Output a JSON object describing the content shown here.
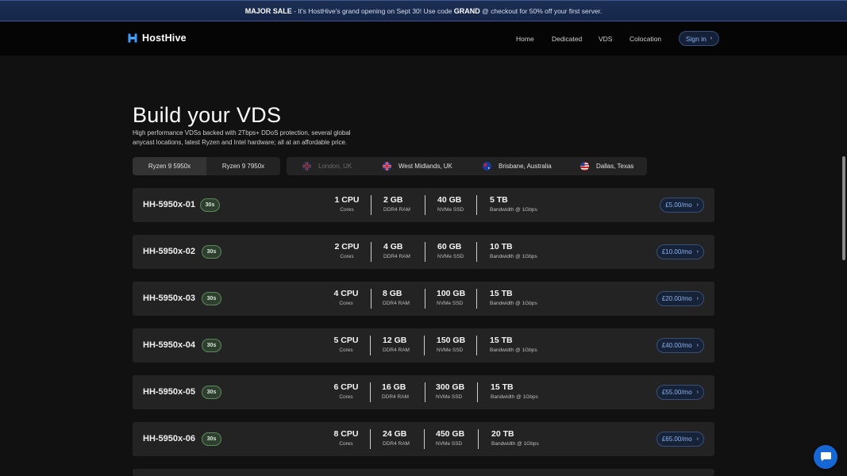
{
  "banner": {
    "label": "MAJOR SALE",
    "text_before_code": " - It's HostHive's grand opening on Sept 30! Use code ",
    "code": "GRAND",
    "text_after_code": " @ checkout for 50% off your first server."
  },
  "nav": {
    "brand": "HostHive",
    "links": [
      "Home",
      "Dedicated",
      "VDS",
      "Colocation"
    ],
    "signin": "Sign in"
  },
  "hero": {
    "title": "Build your VDS",
    "subtitle": "High performance VDSs backed with 2Tbps+ DDoS protection, several global anycast locations, latest Ryzen and Intel hardware; all at an affordable price."
  },
  "cpu_options": [
    "Ryzen 9 5950x",
    "Ryzen 9 7950x"
  ],
  "locations": [
    {
      "label": "London, UK",
      "flag": "uk-flag-icon"
    },
    {
      "label": "West Midlands, UK",
      "flag": "uk-flag-icon"
    },
    {
      "label": "Brisbane, Australia",
      "flag": "australia-flag-icon"
    },
    {
      "label": "Dallas, Texas",
      "flag": "us-flag-icon"
    }
  ],
  "spec_units": {
    "cpu": "Cores",
    "ram": "DDR4 RAM",
    "ssd": "NVMe SSD",
    "bw": "Bandwidth @ 1Gbps"
  },
  "plans": [
    {
      "name": "HH-5950x-01",
      "badge": "30s",
      "cpu": "1 CPU",
      "ram": "2 GB",
      "ssd": "40 GB",
      "bw": "5 TB",
      "price": "£5.00/mo"
    },
    {
      "name": "HH-5950x-02",
      "badge": "30s",
      "cpu": "2 CPU",
      "ram": "4 GB",
      "ssd": "60 GB",
      "bw": "10 TB",
      "price": "£10.00/mo"
    },
    {
      "name": "HH-5950x-03",
      "badge": "30s",
      "cpu": "4 CPU",
      "ram": "8 GB",
      "ssd": "100 GB",
      "bw": "15 TB",
      "price": "£20.00/mo"
    },
    {
      "name": "HH-5950x-04",
      "badge": "30s",
      "cpu": "5 CPU",
      "ram": "12 GB",
      "ssd": "150 GB",
      "bw": "15 TB",
      "price": "£40.00/mo"
    },
    {
      "name": "HH-5950x-05",
      "badge": "30s",
      "cpu": "6 CPU",
      "ram": "16 GB",
      "ssd": "300 GB",
      "bw": "15 TB",
      "price": "£55.00/mo"
    },
    {
      "name": "HH-5950x-06",
      "badge": "30s",
      "cpu": "8 CPU",
      "ram": "24 GB",
      "ssd": "450 GB",
      "bw": "20 TB",
      "price": "£65.00/mo"
    }
  ]
}
